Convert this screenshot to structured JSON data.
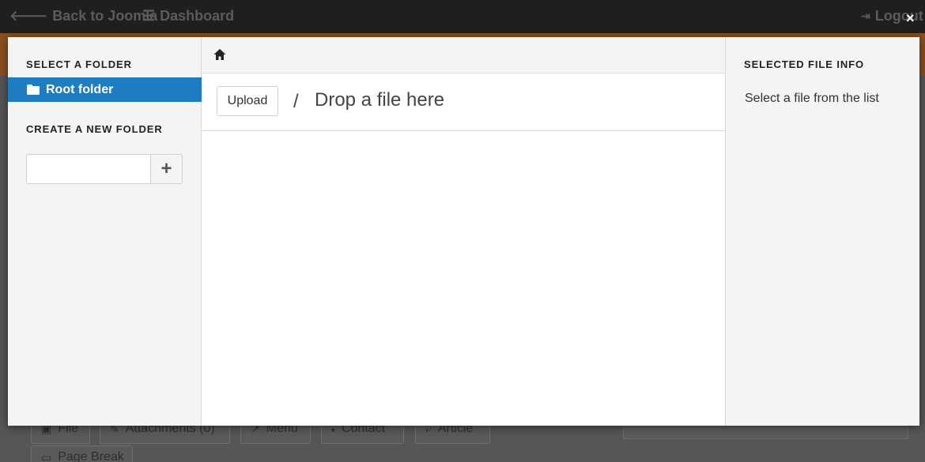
{
  "topbar": {
    "back_label": "Back to Joomla",
    "dashboard_label": "Dashboard",
    "logout_label": "Logout"
  },
  "background_buttons": {
    "file": "File",
    "attachments": "Attachments (0)",
    "menu": "Menu",
    "contact": "Contact",
    "article": "Article",
    "page_break": "Page Break"
  },
  "modal": {
    "close_symbol": "×",
    "left": {
      "select_folder_title": "SELECT A FOLDER",
      "root_folder_label": "Root folder",
      "create_folder_title": "CREATE A NEW FOLDER",
      "new_folder_value": "",
      "add_symbol": "+"
    },
    "middle": {
      "breadcrumb_icon": "home-icon",
      "upload_label": "Upload",
      "separator": "/",
      "drop_text": "Drop a file here"
    },
    "right": {
      "info_title": "SELECTED FILE INFO",
      "info_text": "Select a file from the list"
    }
  },
  "colors": {
    "accent": "#1d7dc0",
    "topbar": "#1f1f1f",
    "orange_strip": "#8a4e1c",
    "panel_bg": "#f4f4f4"
  }
}
